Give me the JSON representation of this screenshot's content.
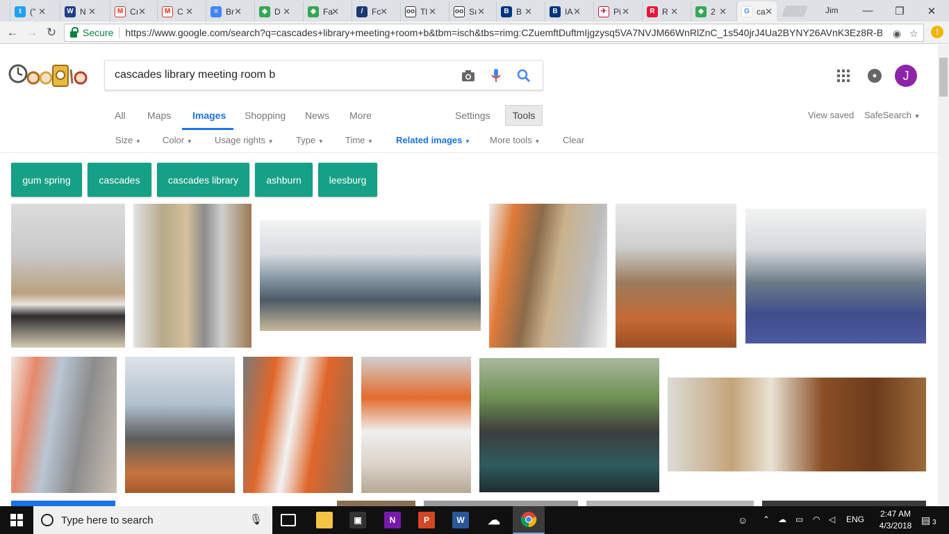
{
  "browser": {
    "tabs": [
      {
        "title": "(\"",
        "favicon": "twitter-icon",
        "color": "#1da1f2"
      },
      {
        "title": "N",
        "favicon": "weather-channel-icon",
        "color": "#1f3c88"
      },
      {
        "title": "Cı",
        "favicon": "gmail-icon",
        "color": "#d93025"
      },
      {
        "title": "C",
        "favicon": "gmail-icon",
        "color": "#d93025"
      },
      {
        "title": "Br",
        "favicon": "google-docs-icon",
        "color": "#4285f4"
      },
      {
        "title": "D",
        "favicon": "google-maps-icon",
        "color": "#34a853"
      },
      {
        "title": "Fa",
        "favicon": "google-maps-icon",
        "color": "#34a853"
      },
      {
        "title": "Fc",
        "favicon": "bookmark-icon",
        "color": "#1a3a6e"
      },
      {
        "title": "Tl",
        "favicon": "tripadvisor-icon",
        "color": "#333333"
      },
      {
        "title": "Sı",
        "favicon": "tripadvisor-icon",
        "color": "#333333"
      },
      {
        "title": "B",
        "favicon": "booking-icon",
        "color": "#003580"
      },
      {
        "title": "IA",
        "favicon": "booking-icon",
        "color": "#003580"
      },
      {
        "title": "Pi",
        "favicon": "airline-icon",
        "color": "#c8102e"
      },
      {
        "title": "R",
        "favicon": "r-icon",
        "color": "#e21a3b"
      },
      {
        "title": "2",
        "favicon": "google-maps-icon",
        "color": "#34a853"
      },
      {
        "title": "ca",
        "favicon": "google-icon",
        "color": "#4285f4"
      }
    ],
    "profile_name": "Jim",
    "secure_label": "Secure",
    "url": "https://www.google.com/search?q=cascades+library+meeting+room+b&tbm=isch&tbs=rimg:CZuemftDuftmIjgzysq5VA7NVJM66WnRlZnC_1s540jrJ4Ua2BYNY26AVnK3Ez8R-B..."
  },
  "search": {
    "query": "cascades library meeting room b"
  },
  "account": {
    "initial": "J"
  },
  "nav": {
    "tabs": [
      "All",
      "Maps",
      "Images",
      "Shopping",
      "News",
      "More"
    ],
    "settings": "Settings",
    "tools": "Tools",
    "view_saved": "View saved",
    "safesearch": "SafeSearch"
  },
  "filters": [
    "Size",
    "Color",
    "Usage rights",
    "Type",
    "Time",
    "Related images",
    "More tools",
    "Clear"
  ],
  "chips": [
    "gum spring",
    "cascades",
    "cascades library",
    "ashburn",
    "leesburg"
  ],
  "taskbar": {
    "search_placeholder": "Type here to search",
    "language": "ENG",
    "time": "2:47 AM",
    "date": "4/3/2018",
    "notification_count": "3"
  }
}
